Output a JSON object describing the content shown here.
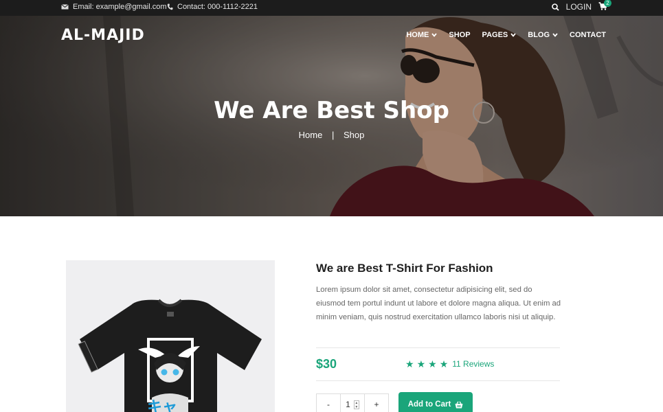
{
  "topbar": {
    "email": "Email: example@gmail.com",
    "contact": "Contact: 000-1112-2221",
    "login": "LOGIN",
    "cart_count": "2"
  },
  "header": {
    "logo": "AL-MAJID",
    "nav": [
      {
        "label": "HOME",
        "dropdown": true
      },
      {
        "label": "SHOP",
        "dropdown": false
      },
      {
        "label": "PAGES",
        "dropdown": true
      },
      {
        "label": "BLOG",
        "dropdown": true
      },
      {
        "label": "CONTACT",
        "dropdown": false
      }
    ]
  },
  "hero": {
    "title": "We Are Best Shop",
    "breadcrumb": [
      "Home",
      "Shop"
    ]
  },
  "product": {
    "title": "We are Best T-Shirt For Fashion",
    "description": "Lorem ipsum dolor sit amet, consectetur adipisicing elit, sed do eiusmod tem portul indunt ut labore et dolore magna aliqua. Ut enim ad minim veniam, quis nostrud exercitation ullamco laboris nisi ut aliquip.",
    "price": "$30",
    "rating": 4,
    "reviews": "11 Reviews",
    "quantity": "1",
    "qty_minus": "-",
    "qty_plus": "+",
    "add_to_cart": "Add to Cart"
  },
  "colors": {
    "accent": "#1aa57a",
    "topbar_bg": "#1c1c1c"
  },
  "icons": [
    "envelope-icon",
    "phone-icon",
    "search-icon",
    "cart-icon",
    "chevron-down-icon",
    "star-icon",
    "basket-icon"
  ]
}
